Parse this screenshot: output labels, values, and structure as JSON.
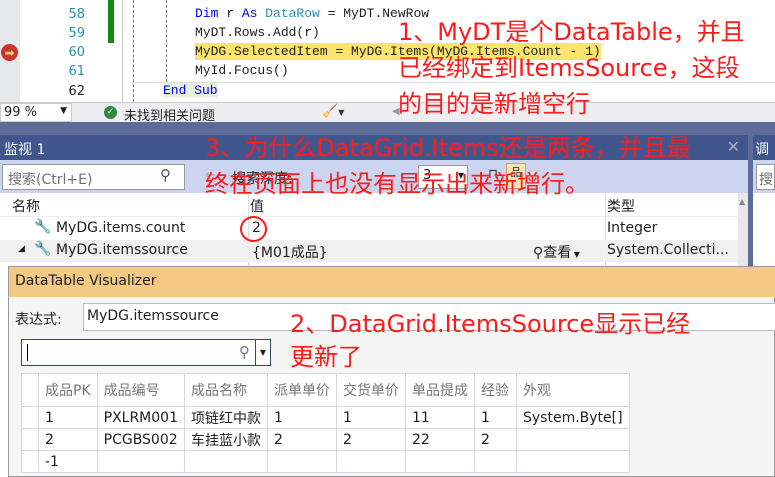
{
  "editor": {
    "line_numbers": [
      "58",
      "59",
      "60",
      "61",
      "62"
    ],
    "lines": [
      {
        "kw1": "Dim",
        "mid": " r ",
        "kw2": "As",
        "ty": " DataRow",
        "rest": " = MyDT.NewRow"
      },
      {
        "text": "MyDT.Rows.Add(r)"
      },
      {
        "text": "MyDG.SelectedItem = MyDG.Items(MyDG.Items.Count - 1)"
      },
      {
        "text": "MyId.Focus()"
      },
      {
        "text": "End Sub"
      }
    ]
  },
  "status": {
    "zoom": "99 %",
    "issues": "未找到相关问题"
  },
  "watch": {
    "title": "监视 1",
    "search_placeholder": "搜索(Ctrl+E)",
    "depth_label": "搜索深度:",
    "depth_value": "3",
    "columns": [
      "名称",
      "值",
      "类型"
    ],
    "rows": [
      {
        "name": "MyDG.items.count",
        "value": "2",
        "type": "Integer"
      },
      {
        "name": "MyDG.itemssource",
        "value": "{M01成品}",
        "view": "查看",
        "type": "System.Collecti..."
      }
    ]
  },
  "right_panel": {
    "title": "调",
    "search": "搜"
  },
  "visualizer": {
    "title": "DataTable Visualizer",
    "expression_label": "表达式:",
    "expression_value": "MyDG.itemssource",
    "columns": [
      "成品PK",
      "成品编号",
      "成品名称",
      "派单单价",
      "交货单价",
      "单品提成",
      "经验",
      "外观"
    ],
    "rows": [
      [
        "1",
        "PXLRM001",
        "项链红中款",
        "1",
        "1",
        "11",
        "1",
        "System.Byte[]"
      ],
      [
        "2",
        "PCGBS002",
        "车挂蓝小款",
        "2",
        "2",
        "22",
        "2",
        ""
      ],
      [
        "-1",
        "",
        "",
        "",
        "",
        "",
        "",
        ""
      ]
    ]
  },
  "annotations": {
    "a1": [
      "1、MyDT是个DataTable，并且",
      "已经绑定到ItemsSource，这段",
      "的目的是新增空行"
    ],
    "a2": [
      "2、DataGrid.ItemsSource显示已经",
      "更新了"
    ],
    "a3": [
      "3、为什么DataGrid.Items还是两条，并且最",
      "终在页面上也没有显示出来新增行。"
    ]
  },
  "colors": {
    "annotation": "#ff1a1a",
    "highlight": "#fbe46b",
    "title_bar": "#40568d",
    "visualizer_title": "#f3c983"
  }
}
